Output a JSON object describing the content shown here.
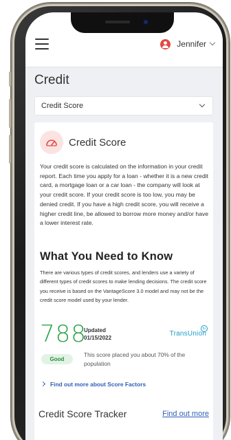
{
  "header": {
    "menu_icon": "hamburger-menu-icon",
    "user_icon": "user-avatar-icon",
    "user_name": "Jennifer"
  },
  "page": {
    "title": "Credit",
    "dropdown_selected": "Credit Score"
  },
  "credit_card": {
    "icon": "speedometer-icon",
    "title": "Credit Score",
    "body": "Your credit score is calculated on the information in your credit report. Each time you apply for a loan - whether it is a new credit card, a mortgage loan or a car loan - the company will look at your credit score. If your credit score is too low, you may be denied credit. If you have a high credit score, you will receive a higher credit line, be allowed to borrow more money and/or have a lower interest rate.",
    "know_title": "What You Need to Know",
    "know_body": "There are various types of credit scores, and lenders use a variety of different types of credit scores to make lending decisions. The credit score you receive is based on the VantageScore 3.0 model and may not be the credit score model used by your lender.",
    "score": "788",
    "updated_label": "Updated",
    "updated_date": "01/15/2022",
    "bureau": "TransUnion",
    "rating": "Good",
    "placement_text": "This score placed you about 70% of the population",
    "more_link": "Find out more about Score Factors"
  },
  "tracker": {
    "title": "Credit Score Tracker",
    "link": "Find out more"
  },
  "colors": {
    "accent_blue": "#2f5fb7",
    "score_green": "#2ea34a",
    "avatar_red": "#e4483f",
    "bureau_blue": "#1a9ec7"
  }
}
